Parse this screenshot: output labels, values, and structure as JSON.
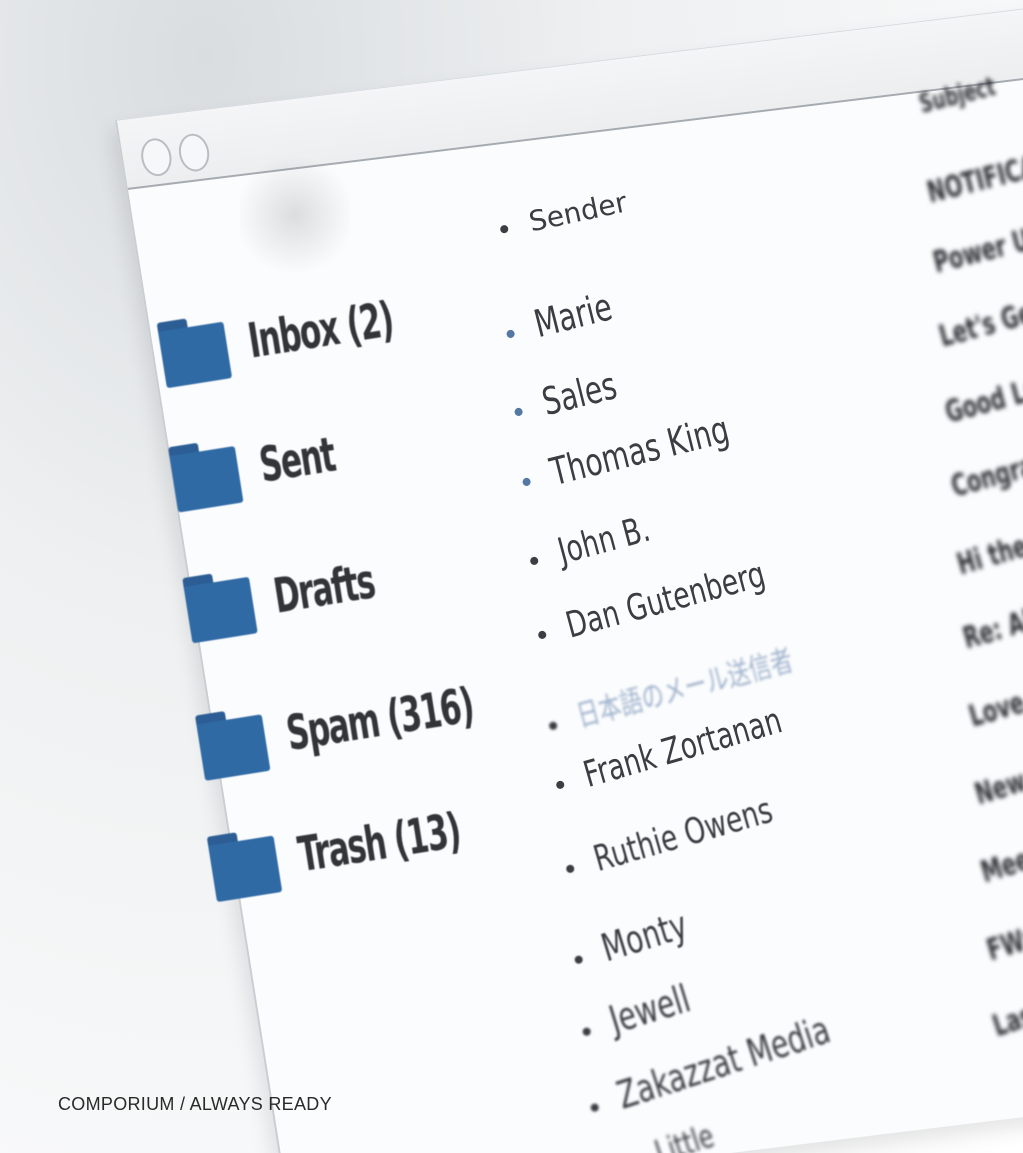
{
  "sidebar": {
    "folders": [
      {
        "label": "Inbox (2)"
      },
      {
        "label": "Sent"
      },
      {
        "label": "Drafts"
      },
      {
        "label": "Spam (316)"
      },
      {
        "label": "Trash (13)"
      }
    ]
  },
  "message_list": {
    "sender_header": "Sender",
    "senders": [
      "Marie",
      "Sales",
      "Thomas King",
      "John B.",
      "Dan Gutenberg",
      "日本語のメール送信者",
      "Frank Zortanan",
      "Ruthie Owens",
      "Monty",
      "Jewell",
      "Zakazzat Media",
      "Little"
    ]
  },
  "subject_column": {
    "header": "Subject",
    "items": [
      "NOTIFICATION",
      "Power Up",
      "Let's Get",
      "Good Luck",
      "Congrats",
      "Hi there",
      "Re: About",
      "Love You",
      "New Order",
      "Meeting",
      "FW: Info",
      "Last"
    ]
  },
  "caption": "COMPORIUM / ALWAYS READY",
  "colors": {
    "folder_icon": "#2f6aa5",
    "bullet": "#5577a3",
    "text": "#323438"
  }
}
